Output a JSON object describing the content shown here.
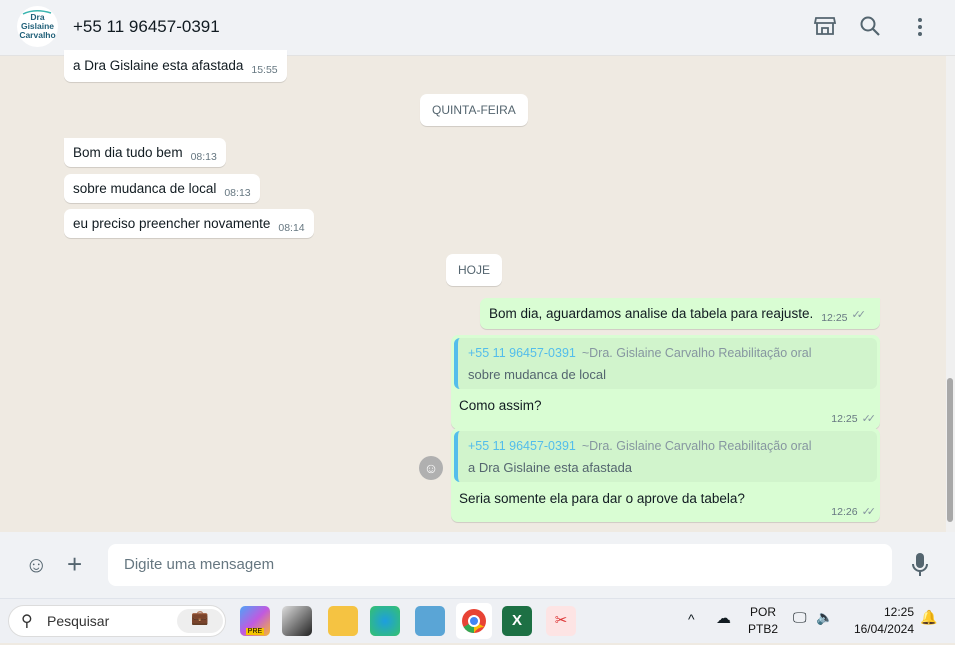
{
  "header": {
    "contact": "+55 11 96457-0391",
    "avatar_text": "Dra Gislaine Carvalho",
    "icons": [
      "shop-icon",
      "search-icon",
      "menu-icon"
    ]
  },
  "messages": {
    "m0": {
      "text": "a Dra Gislaine esta afastada",
      "time": "15:55"
    },
    "d1": "QUINTA-FEIRA",
    "m1": {
      "text": "Bom dia tudo bem",
      "time": "08:13"
    },
    "m2": {
      "text": "sobre mudanca de local",
      "time": "08:13"
    },
    "m3": {
      "text": "eu preciso preencher novamente",
      "time": "08:14"
    },
    "d2": "HOJE",
    "m4": {
      "text": "Bom dia, aguardamos analise da tabela para reajuste.",
      "time": "12:25"
    },
    "m5": {
      "quote_name": "+55 11 96457-0391",
      "quote_alias": "~Dra. Gislaine Carvalho Reabilitação oral",
      "quote_text": "sobre mudanca de local",
      "text": "Como assim?",
      "time": "12:25"
    },
    "m6": {
      "quote_name": "+55 11 96457-0391",
      "quote_alias": "~Dra. Gislaine Carvalho Reabilitação oral",
      "quote_text": "a Dra Gislaine esta afastada",
      "text": "Seria somente ela para dar o aprove da tabela?",
      "time": "12:26"
    }
  },
  "footer": {
    "placeholder": "Digite uma mensagem"
  },
  "taskbar": {
    "search": "Pesquisar",
    "lang1": "POR",
    "lang2": "PTB2",
    "time": "12:25",
    "date": "16/04/2024",
    "copilot_badge": "PRE"
  }
}
